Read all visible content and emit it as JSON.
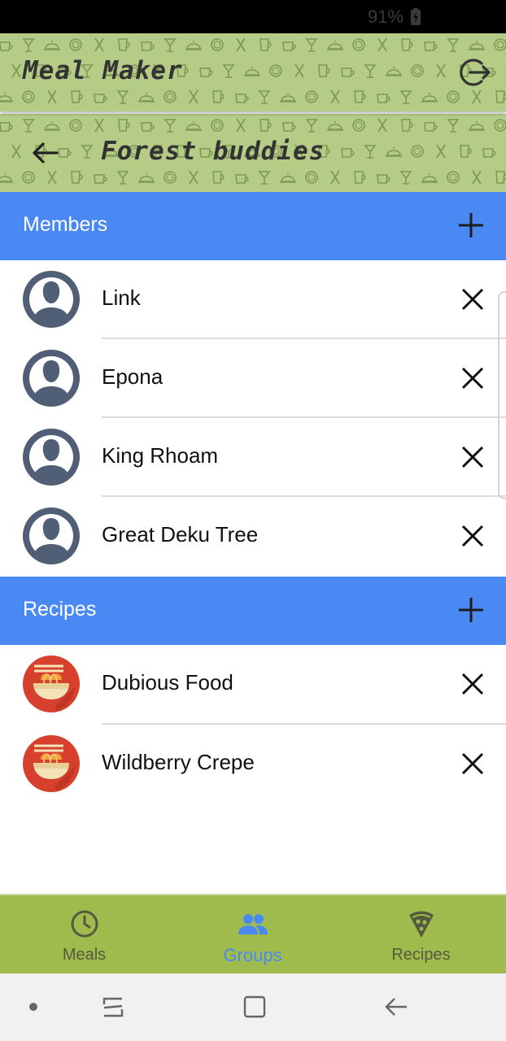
{
  "status_bar": {
    "battery": "91%"
  },
  "app_bar": {
    "title": "Meal Maker",
    "logout_icon": "logout-icon"
  },
  "group_bar": {
    "title": "Forest buddies",
    "back_icon": "arrow-back-icon"
  },
  "members": {
    "header": "Members",
    "add_icon": "plus-icon",
    "items": [
      {
        "name": "Link"
      },
      {
        "name": "Epona"
      },
      {
        "name": "King Rhoam"
      },
      {
        "name": "Great Deku Tree"
      }
    ]
  },
  "recipes": {
    "header": "Recipes",
    "add_icon": "plus-icon",
    "items": [
      {
        "name": "Dubious Food"
      },
      {
        "name": "Wildberry Crepe"
      }
    ]
  },
  "bottom_nav": {
    "items": [
      {
        "label": "Meals",
        "icon": "clock-icon",
        "active": false
      },
      {
        "label": "Groups",
        "icon": "people-icon",
        "active": true
      },
      {
        "label": "Recipes",
        "icon": "pizza-icon",
        "active": false
      }
    ]
  },
  "colors": {
    "header_pattern": "#b5cc86",
    "section_blue": "#4a89f3",
    "bottom_nav": "#a0bb4d",
    "avatar": "#505f75",
    "recipe_icon": "#d8402e"
  }
}
